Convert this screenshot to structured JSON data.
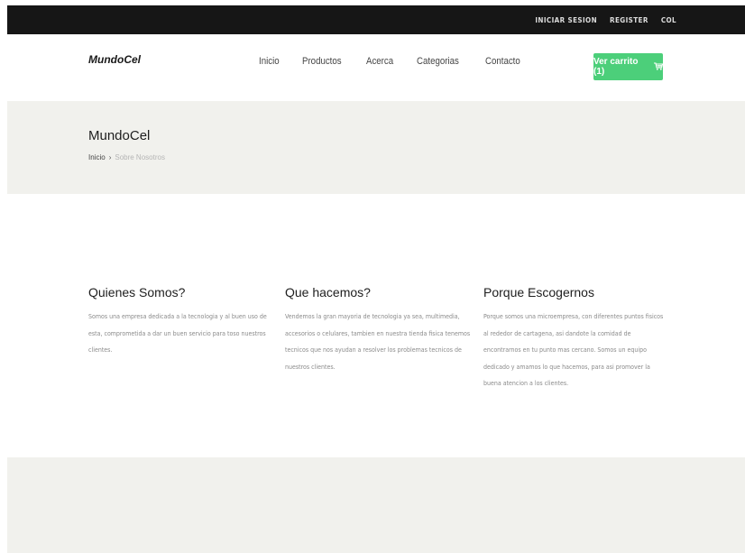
{
  "topbar": {
    "login": "INICIAR SESION",
    "register": "REGISTER",
    "country": "COL"
  },
  "navbar": {
    "brand": "MundoCel",
    "menu": [
      "Inicio",
      "Productos",
      "Acerca",
      "Categorias",
      "Contacto"
    ],
    "cart_label": "Ver carrito (1)",
    "cart_icon": "cart-icon"
  },
  "hero": {
    "title": "MundoCel",
    "breadcrumb_home": "Inicio",
    "breadcrumb_sep": "›",
    "breadcrumb_current": "Sobre Nosotros"
  },
  "sections": [
    {
      "title": "Quienes Somos?",
      "text": "Somos una empresa dedicada a la tecnologia y al buen uso de esta, comprometida a dar un buen servicio para toso nuestros clientes."
    },
    {
      "title": "Que hacemos?",
      "text": "Vendemos la gran mayoria de tecnologia ya sea, multimedia, accesorios o celulares, tambien en nuestra tienda fisica tenemos tecnicos que nos ayudan a resolver los problemas tecnicos de nuestros clientes."
    },
    {
      "title": "Porque Escogernos",
      "text": "Porque somos una microempresa, con diferentes puntos fisicos al rededor de cartagena, asi dandote la comidad de encontrarnos en tu punto mas cercano. Somos un equipo dedicado y amamos lo que hacemos, para asi promover la buena atencion a los clientes."
    }
  ],
  "colors": {
    "topbar_bg": "#161616",
    "accent_green": "#4ccf7a",
    "hero_bg": "#f1f1ed"
  }
}
